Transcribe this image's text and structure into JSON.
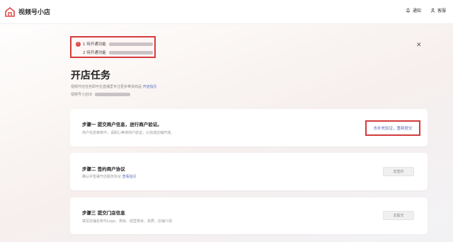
{
  "header": {
    "app_title": "视频号小店",
    "notify_label": "通知",
    "user_label": "客服"
  },
  "notice": {
    "row1_label": "1 待开通功能",
    "row2_label": "2 待开通功能"
  },
  "page": {
    "title": "开店任务",
    "intro_text": "视频开店任务即可在直播里专注更多带货商品",
    "intro_link": "开店指引",
    "shop_id_label": "视频号小店ID"
  },
  "tasks": [
    {
      "title": "步骤一  提交商户信息，进行商户验证。",
      "desc": "商户信息审核中，请耐心等待商户验证，以完成店铺开通。",
      "button": "去补充验证，重新提交"
    },
    {
      "title": "步骤二  签约商户协议",
      "desc": "确认并签署开店服务协议",
      "desc_link": "查看指引",
      "button": "去签约"
    },
    {
      "title": "步骤三  提交门店信息",
      "desc": "填写店铺名称与Logo、类目、经营类目、资质、店铺介绍",
      "button": "去提交"
    }
  ],
  "colors": {
    "highlight_border": "#d43b3b",
    "link": "#5a6ab8",
    "accent_red": "#e04848"
  },
  "icons": {
    "logo": "shop-logo-icon",
    "notify": "bell-icon",
    "user": "user-icon",
    "close": "close-icon"
  }
}
